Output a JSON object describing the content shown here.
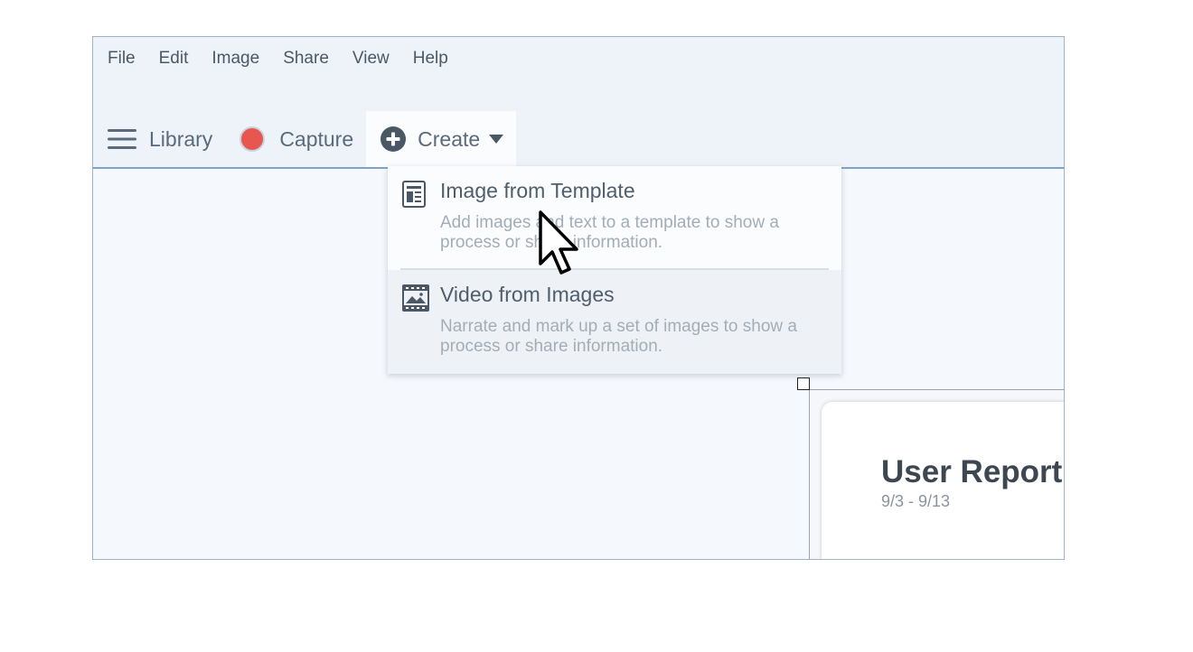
{
  "menubar": {
    "items": [
      "File",
      "Edit",
      "Image",
      "Share",
      "View",
      "Help"
    ]
  },
  "toolbar": {
    "library_label": "Library",
    "capture_label": "Capture",
    "create_label": "Create"
  },
  "create_menu": {
    "items": [
      {
        "title": "Image from Template",
        "description": "Add images and text to a template to show a process or share information."
      },
      {
        "title": "Video from Images",
        "description": "Narrate and mark up a set of images to show a process or share information."
      }
    ]
  },
  "canvas": {
    "card_title": "User Report",
    "card_subtitle": "9/3 - 9/13"
  },
  "colors": {
    "record": "#e8574f",
    "toolbar_border": "#7fa3c6",
    "text": "#4f5e6c"
  },
  "icons": [
    "hamburger-icon",
    "record-icon",
    "plus-circle-icon",
    "caret-down-icon",
    "template-icon",
    "filmstrip-icon",
    "mouse-pointer-icon"
  ]
}
